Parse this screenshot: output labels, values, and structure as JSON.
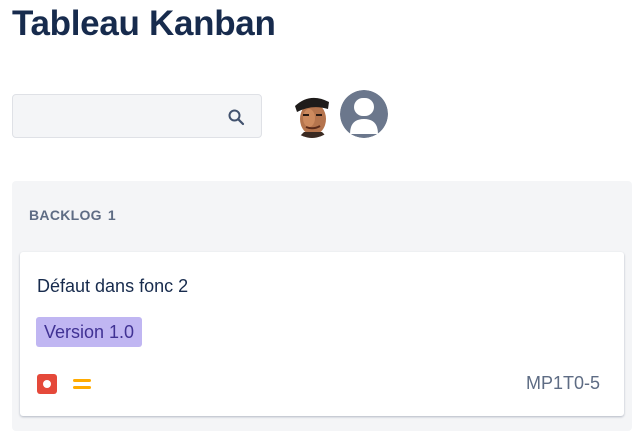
{
  "page": {
    "title": "Tableau Kanban"
  },
  "search": {
    "value": "",
    "placeholder": "",
    "icon": "search-icon"
  },
  "avatars": [
    {
      "name": "user-avatar-photo",
      "icon": "avatar-photo"
    },
    {
      "name": "user-avatar-default",
      "icon": "default-user-icon"
    }
  ],
  "column": {
    "name": "BACKLOG",
    "count": "1",
    "cards": [
      {
        "title": "Défaut dans fonc 2",
        "version": "Version 1.0",
        "type_icon": "bug-icon",
        "priority_icon": "medium-priority-icon",
        "key": "MP1T0-5"
      }
    ]
  },
  "colors": {
    "title": "#172b4d",
    "column_bg": "#f4f5f7",
    "version_bg": "#c0b6f2",
    "version_text": "#403294",
    "bug": "#e5493a",
    "priority_medium": "#ffab00"
  }
}
